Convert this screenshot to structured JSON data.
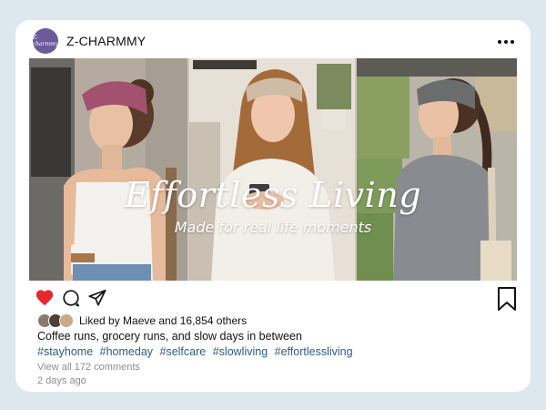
{
  "post": {
    "account_name": "Z-CHARMMY",
    "avatar_text": "Z-charmmy",
    "media": {
      "overlay_title": "Effortless Living",
      "overlay_subtitle": "Made for real life moments",
      "panel_1": "woman-magenta-headband",
      "panel_2": "woman-beige-headband",
      "panel_3": "woman-gray-headband"
    },
    "likes_text": "Liked by Maeve and 16,854 others",
    "caption": "Coffee runs, grocery runs, and slow days in between",
    "hashtags": [
      "#stayhome",
      "#homeday",
      "#selfcare",
      "#slowliving",
      "#effortlessliving"
    ],
    "view_comments": "View all 172 comments",
    "time_ago": "2 days ago"
  },
  "icons": {
    "more": "more-horizontal-icon",
    "like": "heart-icon",
    "comment": "comment-icon",
    "share": "share-icon",
    "save": "bookmark-icon"
  },
  "colors": {
    "background": "#dde7ee",
    "card": "#ffffff",
    "heart": "#e8262d",
    "hashtag": "#2d5c87",
    "avatar": "#6b5b9a",
    "muted": "#8e8e8e"
  }
}
